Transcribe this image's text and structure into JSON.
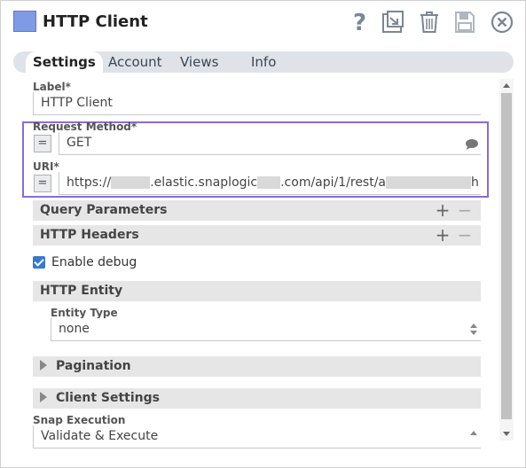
{
  "header": {
    "title": "HTTP Client",
    "accent_color": "#7f9be6",
    "icons": [
      "help-icon",
      "export-icon",
      "delete-icon",
      "save-icon",
      "close-icon"
    ]
  },
  "tabs": [
    {
      "label": "Settings",
      "active": true
    },
    {
      "label": "Account",
      "active": false
    },
    {
      "label": "Views",
      "active": false
    },
    {
      "label": "Info",
      "active": false
    }
  ],
  "fields": {
    "label": {
      "label": "Label*",
      "value": "HTTP Client"
    },
    "request_method": {
      "label": "Request Method*",
      "value": "GET",
      "expr_button": "="
    },
    "uri": {
      "label": "URI*",
      "expr_button": "=",
      "prefix": "https://",
      "middle1": ".elastic.snaplogic",
      "middle2": ".com/api/1/rest/a",
      "suffix": "h"
    }
  },
  "sections": {
    "query_parameters": {
      "label": "Query Parameters",
      "add": "+",
      "remove": "−"
    },
    "http_headers": {
      "label": "HTTP Headers",
      "add": "+",
      "remove": "−"
    },
    "enable_debug": {
      "label": "Enable debug",
      "checked": true
    },
    "http_entity": {
      "label": "HTTP Entity"
    },
    "entity_type": {
      "label": "Entity Type",
      "value": "none"
    },
    "pagination": {
      "label": "Pagination"
    },
    "client_settings": {
      "label": "Client Settings"
    },
    "snap_execution": {
      "label": "Snap Execution",
      "value": "Validate & Execute"
    }
  },
  "colors": {
    "highlight_border": "#8b6cd4",
    "checkbox": "#3b78c8"
  }
}
